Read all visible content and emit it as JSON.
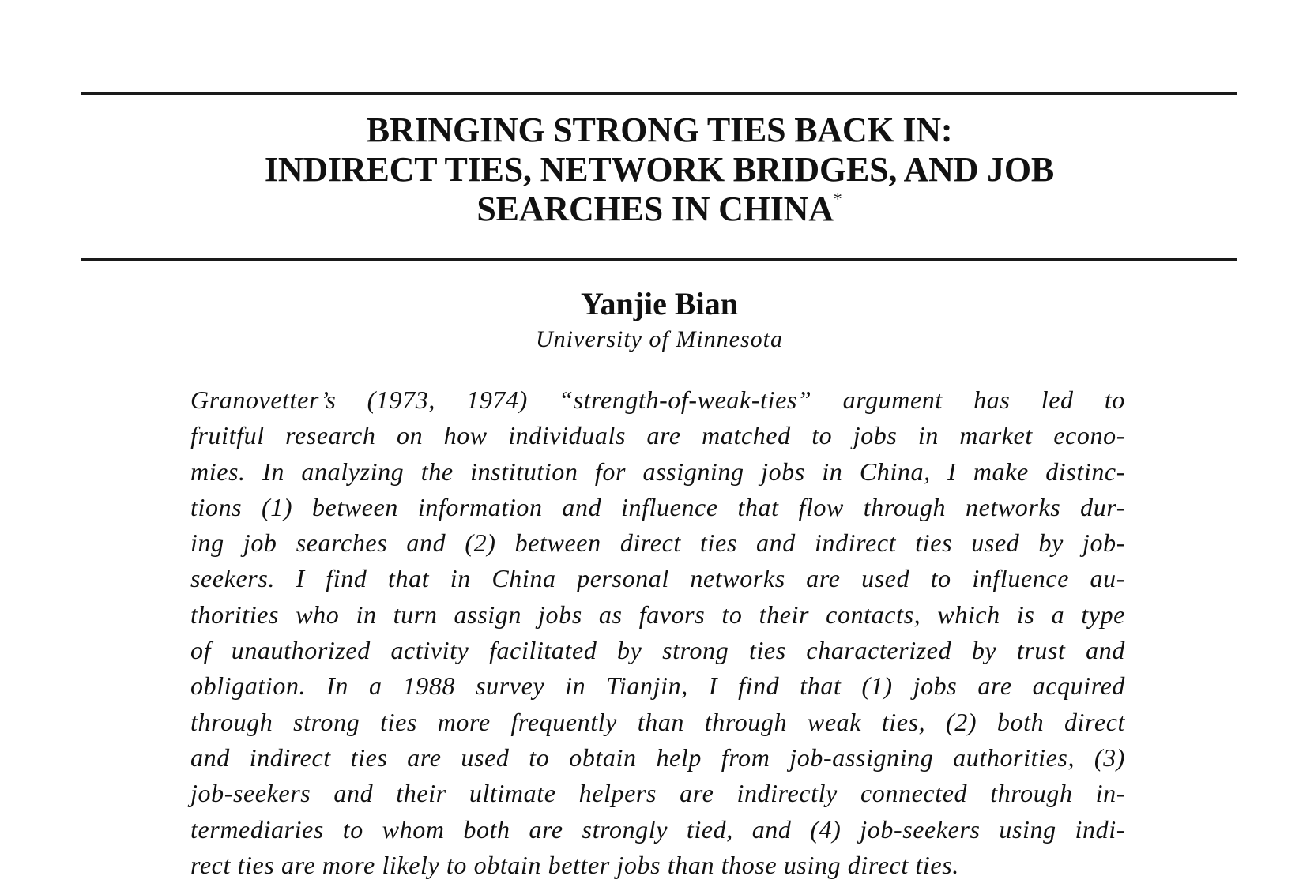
{
  "title": {
    "lines": [
      "BRINGING STRONG TIES BACK IN:",
      "INDIRECT TIES, NETWORK BRIDGES, AND JOB",
      "SEARCHES IN CHINA"
    ],
    "footnote_mark": "*"
  },
  "author": {
    "name": "Yanjie Bian",
    "affiliation": "University of Minnesota"
  },
  "abstract": {
    "lines": [
      "Granovetter’s (1973, 1974) “strength-of-weak-ties” argument has led to",
      "fruitful research on how individuals are matched to jobs in market econo-",
      "mies. In analyzing the institution for assigning jobs in China, I make distinc-",
      "tions (1) between information and influence that flow through networks dur-",
      "ing job searches and (2) between direct ties and indirect ties used by job-",
      "seekers. I find that in China personal networks are used to influence au-",
      "thorities who in turn assign jobs as favors to their contacts, which is a type",
      "of unauthorized activity facilitated by strong ties characterized by trust and",
      "obligation. In a 1988 survey in Tianjin, I find that (1) jobs are acquired",
      "through strong ties more frequently than through weak ties, (2) both direct",
      "and indirect ties are used to obtain help from job-assigning authorities, (3)",
      "job-seekers and their ultimate helpers are indirectly connected through in-",
      "termediaries to whom both are strongly tied, and (4) job-seekers using indi-",
      "rect ties are more likely to obtain better jobs than those using direct ties."
    ]
  }
}
